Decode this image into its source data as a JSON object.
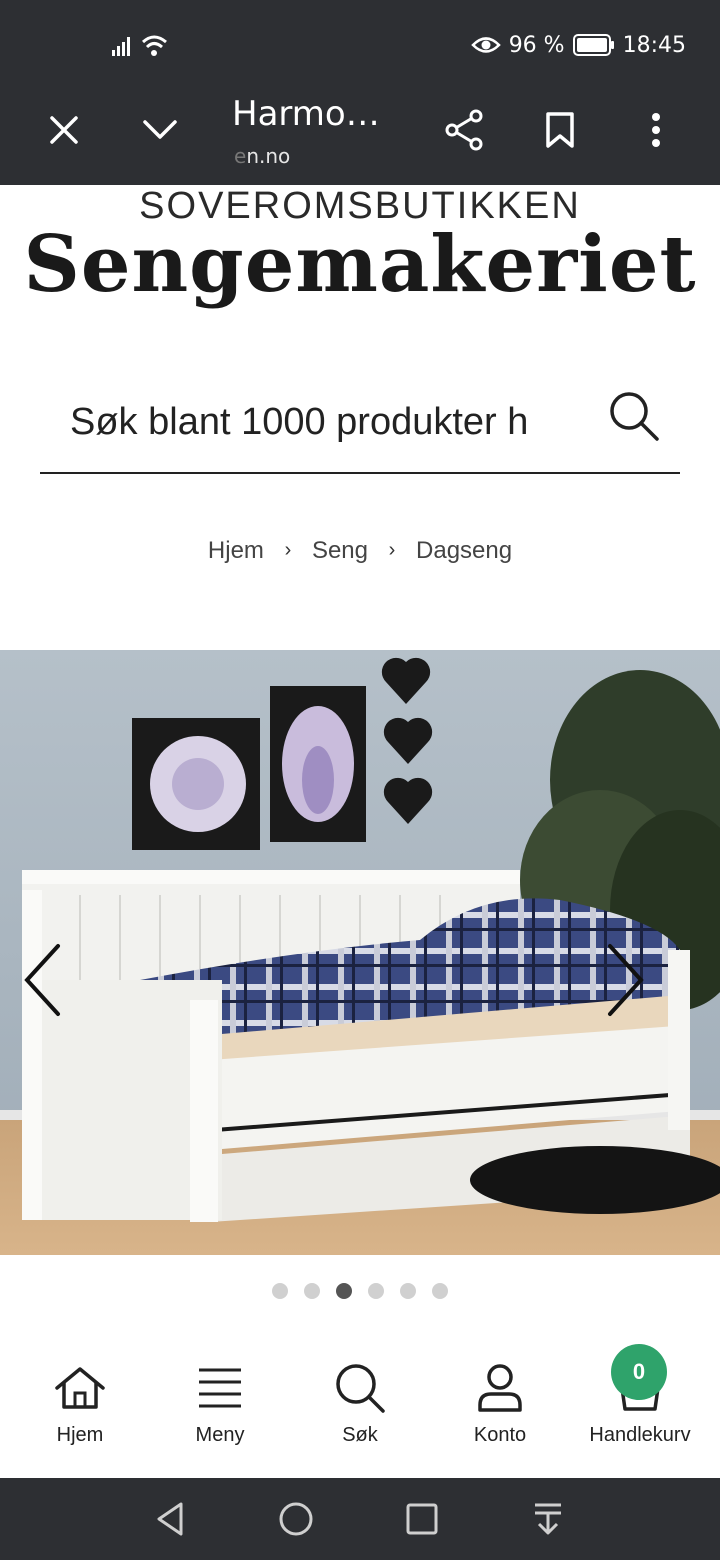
{
  "status_bar": {
    "battery": "96 %",
    "time": "18:45"
  },
  "browser": {
    "page_title": "Harmo…",
    "url_fade": "e",
    "url_rest": "n.no"
  },
  "logo": {
    "top_text": "SOVEROMSBUTIKKEN",
    "main_text": "Sengemakeriet"
  },
  "search": {
    "placeholder": "Søk blant 1000 produkter h"
  },
  "breadcrumb": {
    "items": [
      "Hjem",
      "Seng",
      "Dagseng"
    ]
  },
  "gallery": {
    "slide_count": 6,
    "active_index": 2
  },
  "tabbar": {
    "items": [
      {
        "label": "Hjem",
        "icon": "home-icon"
      },
      {
        "label": "Meny",
        "icon": "menu-icon"
      },
      {
        "label": "Søk",
        "icon": "search-icon"
      },
      {
        "label": "Konto",
        "icon": "account-icon"
      },
      {
        "label": "Handlekurv",
        "icon": "cart-icon"
      }
    ],
    "cart_count": "0"
  },
  "colors": {
    "topbar": "#2d2f33",
    "badge": "#2fa36b"
  }
}
